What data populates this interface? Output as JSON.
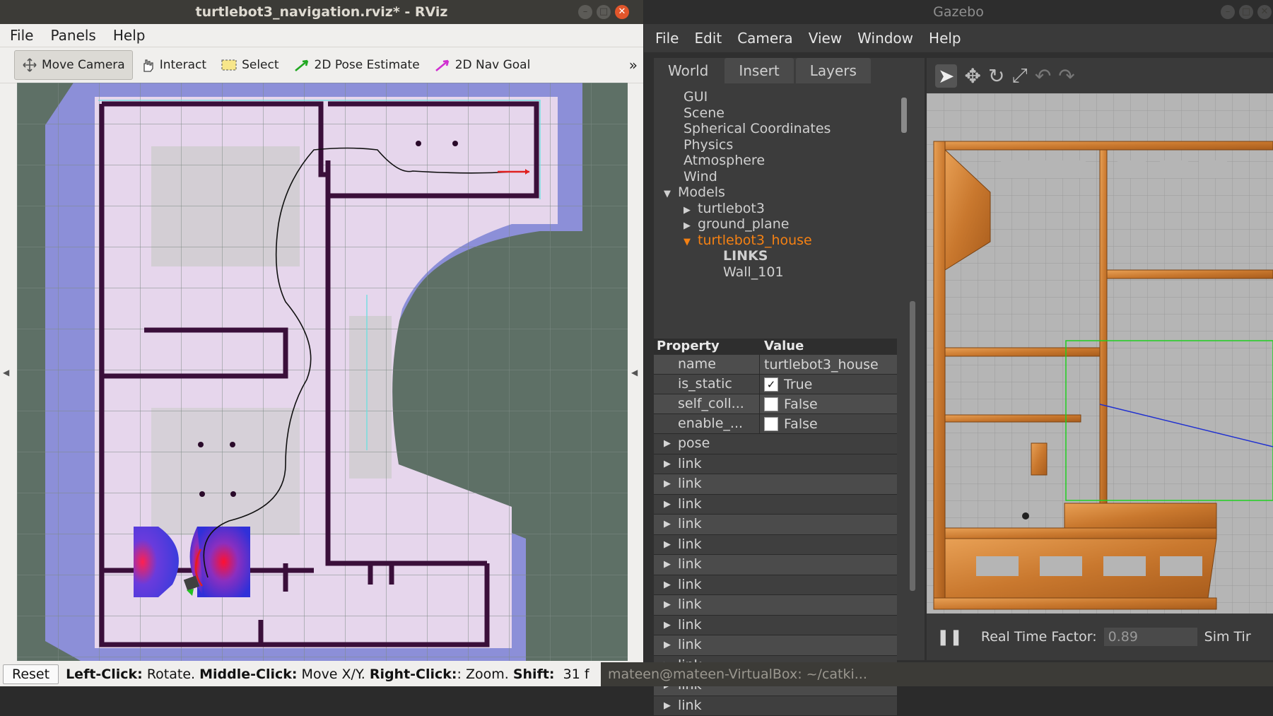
{
  "rviz": {
    "title": "turtlebot3_navigation.rviz* - RViz",
    "menu": [
      "File",
      "Panels",
      "Help"
    ],
    "tools": [
      {
        "label": "Move Camera",
        "icon": "move-camera-icon"
      },
      {
        "label": "Interact",
        "icon": "hand-icon"
      },
      {
        "label": "Select",
        "icon": "select-rect-icon"
      },
      {
        "label": "2D Pose Estimate",
        "icon": "green-arrow-icon"
      },
      {
        "label": "2D Nav Goal",
        "icon": "magenta-arrow-icon"
      }
    ],
    "more_label": "»",
    "status": {
      "reset": "Reset",
      "l_key": "Left-Click:",
      "l_val": "Rotate.",
      "m_key": "Middle-Click:",
      "m_val": "Move X/Y.",
      "r_key": "Right-Click:",
      "r_val": ": Zoom.",
      "s_key": "Shift:",
      "fps": "31 f"
    }
  },
  "gazebo": {
    "title": "Gazebo",
    "menu": [
      "File",
      "Edit",
      "Camera",
      "View",
      "Window",
      "Help"
    ],
    "tabs": [
      "World",
      "Insert",
      "Layers"
    ],
    "tree": {
      "top_items": [
        "GUI",
        "Scene",
        "Spherical Coordinates",
        "Physics",
        "Atmosphere",
        "Wind"
      ],
      "models_label": "Models",
      "models": [
        "turtlebot3",
        "ground_plane",
        "turtlebot3_house"
      ],
      "links_label": "LINKS",
      "wall_label": "Wall_101"
    },
    "property_header": {
      "property": "Property",
      "value": "Value"
    },
    "properties": [
      {
        "name": "name",
        "value": "turtlebot3_house",
        "checkbox": ""
      },
      {
        "name": "is_static",
        "value": "True",
        "checkbox": "✓"
      },
      {
        "name": "self_coll...",
        "value": "False",
        "checkbox": " "
      },
      {
        "name": "enable_...",
        "value": "False",
        "checkbox": " "
      }
    ],
    "pose_label": "pose",
    "link_label": "link",
    "bottom": {
      "rtf_label": "Real Time Factor:",
      "rtf_value": "0.89",
      "sim_label": "Sim Tir"
    },
    "accent_color": "#f58113"
  },
  "terminal": {
    "title": "mateen@mateen-VirtualBox: ~/catki..."
  }
}
